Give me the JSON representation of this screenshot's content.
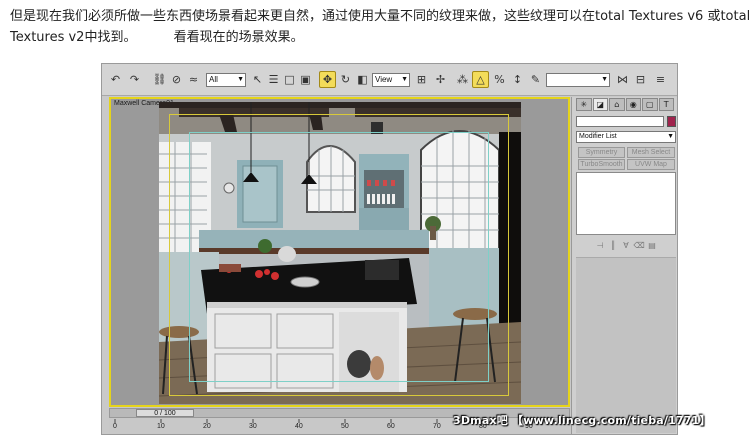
{
  "article": {
    "line1": "但是现在我们必须所做一些东西使场景看起来更自然，通过使用大量不同的纹理来做，这些纹理可以在total Textures v6 或total",
    "line2_a": "Textures v2中找到。",
    "line2_b": "看看现在的场景效果。"
  },
  "toolbar": {
    "selection_filter": "All",
    "reference_coord": "View",
    "named_selection": "",
    "icons": [
      "undo-icon",
      "redo-icon",
      "link-icon",
      "unlink-icon",
      "bind-space-warp-icon",
      "select-object-icon",
      "select-by-name-icon",
      "rect-region-icon",
      "window-crossing-icon",
      "move-icon",
      "rotate-icon",
      "scale-icon",
      "pivot-icon",
      "manipulate-icon",
      "snap-icon",
      "angle-snap-icon",
      "percent-snap-icon",
      "spinner-snap-icon",
      "edit-named-selection-icon",
      "mirror-icon",
      "align-icon",
      "layer-icon"
    ]
  },
  "viewport": {
    "label": "Maxwell Camera01"
  },
  "command_panel": {
    "tabs": [
      "create",
      "modify",
      "hierarchy",
      "motion",
      "display",
      "utilities"
    ],
    "object_name": "",
    "object_color": "#a0234d",
    "modifier_list_label": "Modifier List",
    "modifier_buttons": [
      "Symmetry",
      "Mesh Select",
      "TurboSmooth",
      "UVW Map"
    ],
    "stack_tools": [
      "pin-stack-icon",
      "show-end-result-icon",
      "make-unique-icon",
      "remove-modifier-icon",
      "configure-modifier-sets-icon"
    ]
  },
  "timeline": {
    "frame_counter": "0 / 100",
    "ruler_labels": [
      "0",
      "10",
      "20",
      "30",
      "40",
      "50",
      "60",
      "70",
      "80",
      "90"
    ]
  },
  "watermark": "3Dmax吧 【www.linecg.com/tieba/1771】"
}
